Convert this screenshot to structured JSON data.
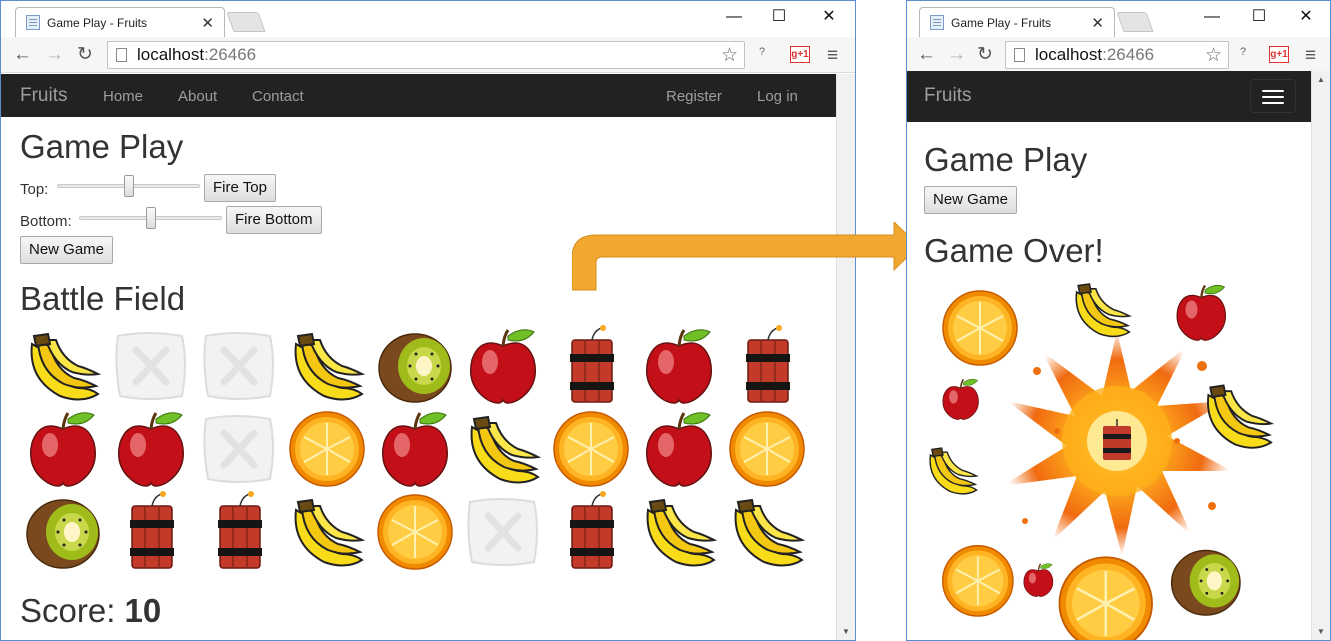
{
  "browser": {
    "tab_title": "Game Play - Fruits",
    "tab_close": "✕",
    "url_host": "localhost",
    "url_port": ":26466",
    "minimize_label": "—",
    "maximize_label": "☐",
    "close_label": "✕",
    "back_label": "←",
    "forward_label": "→",
    "reload_label": "↻",
    "bookmark_label": "☆",
    "ext_label": "?",
    "gplus_label": "g+1",
    "menu_label": "≡",
    "scroll_down": "▼",
    "scroll_up": "▲"
  },
  "site": {
    "brand": "Fruits",
    "nav": [
      "Home",
      "About",
      "Contact"
    ],
    "nav_right": [
      "Register",
      "Log in"
    ]
  },
  "left": {
    "title": "Game Play",
    "top_label": "Top:",
    "fire_top": "Fire Top",
    "top_level": 0.5,
    "bottom_label": "Bottom:",
    "fire_bottom": "Fire Bottom",
    "bottom_level": 0.5,
    "new_game": "New Game",
    "field_title": "Battle Field",
    "score_label": "Score:",
    "score_value": "10",
    "grid": [
      [
        "banana",
        "empty",
        "empty",
        "banana",
        "kiwi",
        "apple",
        "dynamite",
        "apple",
        "dynamite"
      ],
      [
        "apple",
        "apple",
        "empty",
        "orange",
        "apple",
        "banana",
        "orange",
        "apple",
        "orange"
      ],
      [
        "kiwi",
        "dynamite",
        "dynamite",
        "banana",
        "orange",
        "empty",
        "dynamite",
        "banana",
        "banana"
      ]
    ]
  },
  "right": {
    "title": "Game Play",
    "new_game": "New Game",
    "game_over": "Game Over!"
  },
  "colors": {
    "navbar": "#222222",
    "nav_text": "#9d9d9d",
    "arrow": "#f0a830",
    "window_border": "#5a8ed1"
  },
  "icons": {
    "banana": "banana-icon",
    "apple": "apple-icon",
    "kiwi": "kiwi-icon",
    "orange": "orange-icon",
    "dynamite": "dynamite-icon",
    "empty": "empty-tile-icon"
  }
}
